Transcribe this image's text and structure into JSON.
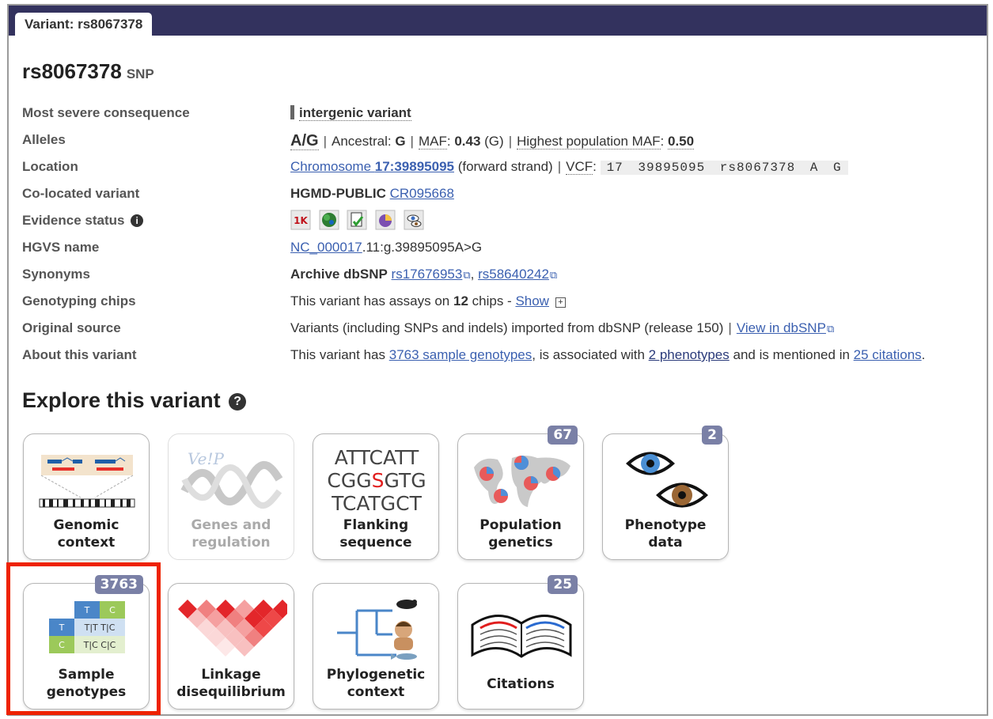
{
  "tab": {
    "label": "Variant: rs8067378"
  },
  "variant": {
    "id": "rs8067378",
    "type": "SNP"
  },
  "labels": {
    "consequence": "Most severe consequence",
    "alleles": "Alleles",
    "location": "Location",
    "colocated": "Co-located variant",
    "evidence": "Evidence status",
    "hgvs": "HGVS name",
    "synonyms": "Synonyms",
    "chips": "Genotyping chips",
    "source": "Original source",
    "about": "About this variant"
  },
  "consequence": {
    "value": "intergenic variant"
  },
  "alleles": {
    "value": "A/G",
    "ancestral_label": "Ancestral:",
    "ancestral": "G",
    "maf_label": "MAF",
    "maf": "0.43",
    "maf_allele": "(G)",
    "highest_label": "Highest population MAF",
    "highest": "0.50"
  },
  "location": {
    "chrom_text": "Chromosome ",
    "chrom_pos": "17:39895095",
    "strand": " (forward strand)",
    "vcf_label": "VCF",
    "vcf": "17 39895095 rs8067378 A G"
  },
  "colocated": {
    "source": "HGMD-PUBLIC",
    "id": "CR095668"
  },
  "evidence": {
    "info": "i",
    "icons": [
      "1000-genomes-icon",
      "frequency-icon",
      "cited-icon",
      "phenotype-icon",
      "hapmap-icon"
    ]
  },
  "hgvs": {
    "ref": "NC_000017",
    "rest": ".11:g.39895095A>G"
  },
  "synonyms": {
    "source": "Archive dbSNP",
    "ids": [
      "rs17676953",
      "rs58640242"
    ]
  },
  "chips": {
    "pre": "This variant has assays on ",
    "count": "12",
    "post": " chips - ",
    "show": "Show",
    "plus": "+"
  },
  "source": {
    "text": "Variants (including SNPs and indels) imported from dbSNP (release 150)",
    "link": "View in dbSNP"
  },
  "about": {
    "t1": "This variant has ",
    "genotypes": "3763 sample genotypes",
    "t2": ", is associated with ",
    "phenotypes": "2 phenotypes",
    "t3": " and is mentioned in ",
    "citations": "25 citations",
    "t4": "."
  },
  "explore": {
    "title": "Explore this variant",
    "help": "?"
  },
  "tiles": {
    "genomic": {
      "line1": "Genomic",
      "line2": "context"
    },
    "genes": {
      "line1": "Genes and",
      "line2": "regulation",
      "logo": "Ve!P"
    },
    "flanking": {
      "line1": "Flanking",
      "line2": "sequence",
      "seq": [
        "ATTCATT",
        "CGG",
        "S",
        "GTG",
        "TCATGCT"
      ]
    },
    "population": {
      "line1": "Population",
      "line2": "genetics",
      "badge": "67"
    },
    "phenotype": {
      "line1": "Phenotype",
      "line2": "data",
      "badge": "2"
    },
    "samples": {
      "line1": "Sample",
      "line2": "genotypes",
      "badge": "3763"
    },
    "ld": {
      "line1": "Linkage",
      "line2": "disequilibrium"
    },
    "phylo": {
      "line1": "Phylogenetic",
      "line2": "context"
    },
    "citations": {
      "line1": "Citations",
      "badge": "25"
    }
  },
  "colors": {
    "header": "#33325e",
    "link": "#3b60b0",
    "badge": "#7a80a6",
    "highlight": "#ee2200"
  }
}
